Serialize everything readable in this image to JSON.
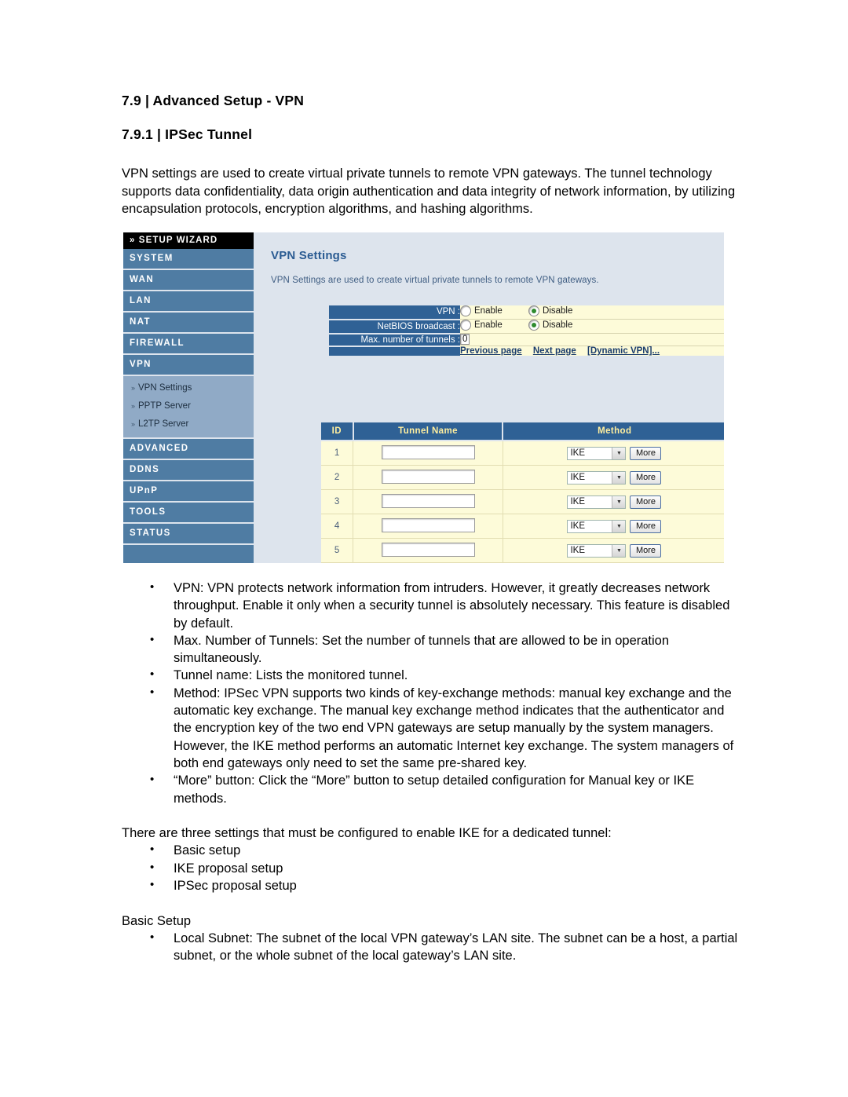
{
  "document": {
    "heading_main": "7.9 | Advanced Setup - VPN",
    "heading_sub": "7.9.1 | IPSec Tunnel",
    "intro_paragraph": "VPN settings are used to create virtual private tunnels to remote VPN gateways. The tunnel technology supports data confidentiality, data origin authentication and data integrity of network information, by utilizing encapsulation protocols, encryption algorithms, and hashing algorithms.",
    "bullets": [
      "VPN: VPN protects network information from intruders. However, it greatly decreases network throughput. Enable it only when a security tunnel is absolutely necessary. This feature is disabled by default.",
      "Max. Number of Tunnels: Set the number of tunnels that are allowed to be in operation simultaneously.",
      "Tunnel name: Lists the monitored tunnel.",
      "Method: IPSec VPN supports two kinds of key-exchange methods: manual key exchange and the automatic key exchange. The manual key exchange method indicates that the authenticator and the encryption key of the two end VPN gateways are setup manually by the system managers. However, the IKE method performs an automatic Internet key exchange. The system managers of both end gateways only need to set the same pre-shared key.",
      "“More” button: Click the “More” button to setup detailed configuration for Manual key or IKE methods."
    ],
    "ike_intro": "There are three settings that must be configured to enable IKE for a dedicated tunnel:",
    "ike_settings": [
      "Basic setup",
      "IKE proposal setup",
      "IPSec proposal setup"
    ],
    "basic_setup_heading": "Basic Setup",
    "basic_setup_bullets": [
      "Local Subnet: The subnet of the local VPN gateway’s LAN site. The subnet can be a host, a partial subnet, or the whole subnet of the local gateway’s LAN site."
    ]
  },
  "router_ui": {
    "sidebar": {
      "wizard": {
        "label": "SETUP WIZARD",
        "arrow_icon": "double-chevron-right-icon"
      },
      "items": [
        {
          "label": "SYSTEM"
        },
        {
          "label": "WAN"
        },
        {
          "label": "LAN"
        },
        {
          "label": "NAT"
        },
        {
          "label": "FIREWALL"
        },
        {
          "label": "VPN"
        }
      ],
      "submenu": [
        {
          "label": "VPN Settings",
          "arrow_icon": "chevron-right-icon"
        },
        {
          "label": "PPTP Server",
          "arrow_icon": "chevron-right-icon"
        },
        {
          "label": "L2TP Server",
          "arrow_icon": "chevron-right-icon"
        }
      ],
      "items_after": [
        {
          "label": "ADVANCED"
        },
        {
          "label": "DDNS"
        },
        {
          "label": "UPnP"
        },
        {
          "label": "TOOLS"
        },
        {
          "label": "STATUS"
        }
      ]
    },
    "panel": {
      "title": "VPN Settings",
      "description": "VPN Settings are used to create virtual private tunnels to remote VPN gateways."
    },
    "settings": {
      "rows": [
        {
          "label": "VPN :",
          "type": "radio",
          "options": [
            {
              "label": "Enable",
              "selected": false
            },
            {
              "label": "Disable",
              "selected": true
            }
          ]
        },
        {
          "label": "NetBIOS broadcast :",
          "type": "radio",
          "options": [
            {
              "label": "Enable",
              "selected": false
            },
            {
              "label": "Disable",
              "selected": true
            }
          ]
        },
        {
          "label": "Max. number of tunnels :",
          "type": "text",
          "value": "0"
        }
      ],
      "links": [
        {
          "label": "Previous page"
        },
        {
          "label": "Next page"
        },
        {
          "label": "[Dynamic VPN]..."
        }
      ]
    },
    "tunnel_table": {
      "columns": [
        "ID",
        "Tunnel Name",
        "Method"
      ],
      "rows": [
        {
          "id": "1",
          "tunnel_name": "",
          "method": "IKE",
          "more_label": "More"
        },
        {
          "id": "2",
          "tunnel_name": "",
          "method": "IKE",
          "more_label": "More"
        },
        {
          "id": "3",
          "tunnel_name": "",
          "method": "IKE",
          "more_label": "More"
        },
        {
          "id": "4",
          "tunnel_name": "",
          "method": "IKE",
          "more_label": "More"
        },
        {
          "id": "5",
          "tunnel_name": "",
          "method": "IKE",
          "more_label": "More"
        }
      ]
    },
    "colors": {
      "nav_blue": "#4f7ca3",
      "submenu_blue": "#90aac6",
      "panel_bg": "#dde4ed",
      "header_blue": "#2f6195",
      "field_yellow": "#fdfbd9",
      "title_blue": "#2a5b92",
      "link_navy": "#1b3d6d",
      "radio_green": "#2f8b2f",
      "header_text_yellow": "#ffef9f"
    }
  }
}
